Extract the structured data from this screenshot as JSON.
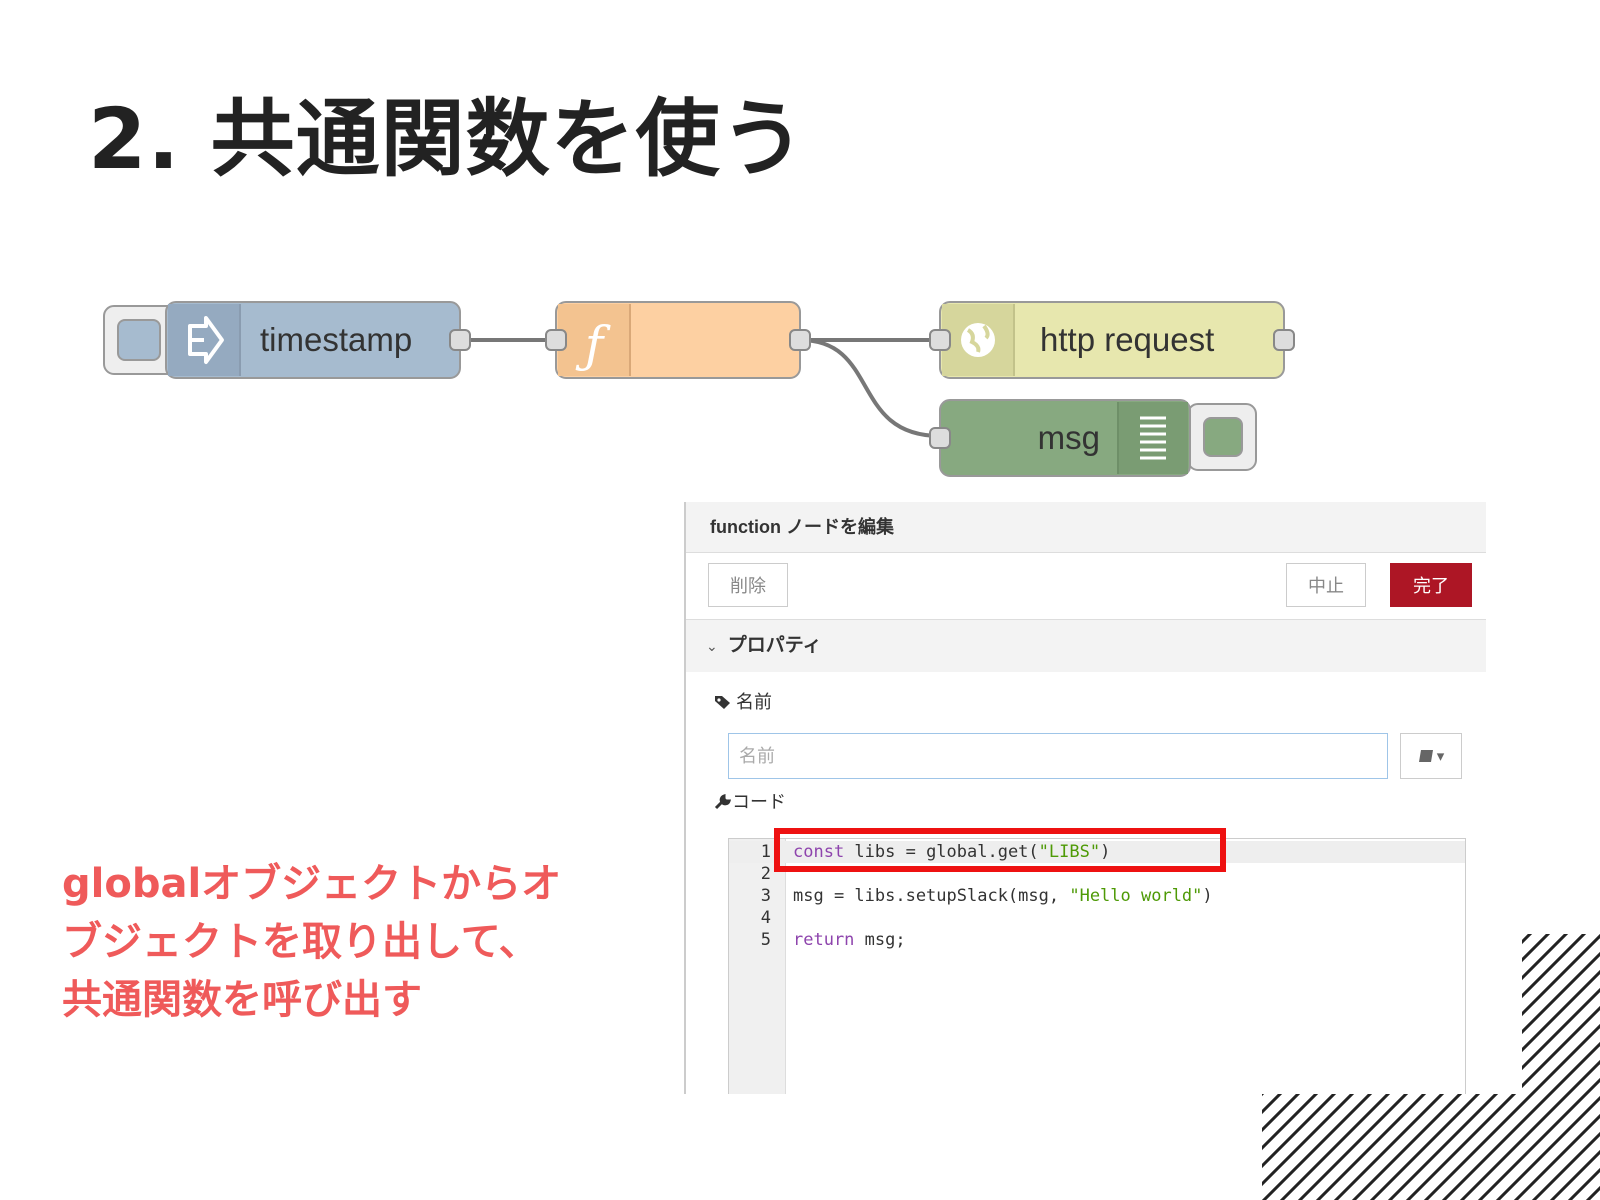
{
  "slide": {
    "title": "2. 共通関数を使う"
  },
  "flow": {
    "nodes": [
      {
        "id": "inject",
        "label": "timestamp",
        "icon": "arrow-right-icon",
        "color": "#a6bbcf"
      },
      {
        "id": "function",
        "label": "",
        "icon": "function-icon",
        "color": "#fdd0a2"
      },
      {
        "id": "http",
        "label": "http request",
        "icon": "globe-icon",
        "color": "#e7e7ae"
      },
      {
        "id": "debug",
        "label": "msg",
        "icon": "debug-list-icon",
        "color": "#87a980"
      }
    ]
  },
  "annotation": {
    "lines": [
      "globalオブジェクトからオ",
      "ブジェクトを取り出して、",
      "共通関数を呼び出す"
    ]
  },
  "editor": {
    "header": "function ノードを編集",
    "buttons": {
      "delete": "削除",
      "cancel": "中止",
      "done": "完了"
    },
    "section": {
      "chevron": "⌄",
      "title": "プロパティ"
    },
    "name_label": "名前",
    "name_placeholder": "名前",
    "code_label": "コード",
    "code_lines": [
      {
        "num": "1",
        "kw": "const",
        "before": "",
        "after": " libs = global.get(",
        "str": "\"LIBS\"",
        "tail": ")"
      },
      {
        "num": "2",
        "kw": "",
        "before": "",
        "after": "",
        "str": "",
        "tail": ""
      },
      {
        "num": "3",
        "kw": "",
        "before": "",
        "after": "msg = libs.setupSlack(msg, ",
        "str": "\"Hello world\"",
        "tail": ")"
      },
      {
        "num": "4",
        "kw": "",
        "before": "",
        "after": "",
        "str": "",
        "tail": ""
      },
      {
        "num": "5",
        "kw": "return",
        "before": "",
        "after": " msg;",
        "str": "",
        "tail": ""
      }
    ]
  },
  "colors": {
    "accent_red": "#ef5a5a",
    "done_button": "#ad1625",
    "highlight_box": "#ee1111"
  }
}
